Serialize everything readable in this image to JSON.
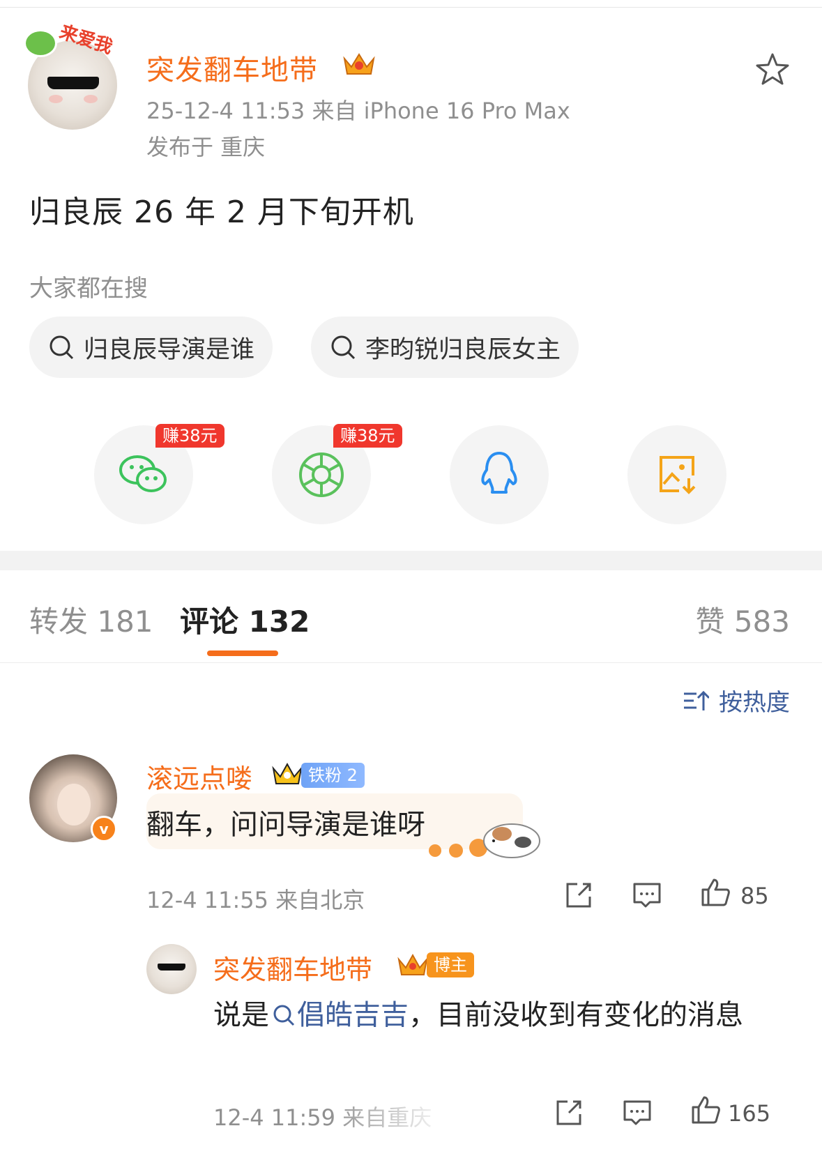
{
  "post": {
    "author": "突发翻车地带",
    "avatar_sticker_text": "来爱我",
    "meta": "25-12-4 11:53  来自 iPhone 16 Pro Max",
    "location": "发布于 重庆",
    "text": "归良辰 26 年 2 月下旬开机"
  },
  "search": {
    "label": "大家都在搜",
    "chips": [
      "归良辰导演是谁",
      "李昀锐归良辰女主"
    ]
  },
  "share": {
    "badge_1": "赚38元",
    "badge_2": "赚38元",
    "icons": [
      "wechat-icon",
      "moments-icon",
      "qq-icon",
      "save-image-icon"
    ]
  },
  "tabs": {
    "repost": "转发 181",
    "comments": "评论 132",
    "likes": "赞 583"
  },
  "sort": {
    "label": "按热度"
  },
  "comment": {
    "name": "滚远点喽",
    "fan_badge": "铁粉 2",
    "text": "翻车，问问导演是谁呀",
    "time": "12-4 11:55  来自北京",
    "likes": "85"
  },
  "reply": {
    "name": "突发翻车地带",
    "badge": "博主",
    "prefix": "说是",
    "link": "倡皓吉吉",
    "suffix": "，目前没收到有变化的消息",
    "time": "12-4 11:59  来自重庆",
    "likes": "165"
  },
  "colors": {
    "accent": "#f56d1b",
    "link": "#3f5f9c",
    "muted": "#8f8f8f"
  }
}
